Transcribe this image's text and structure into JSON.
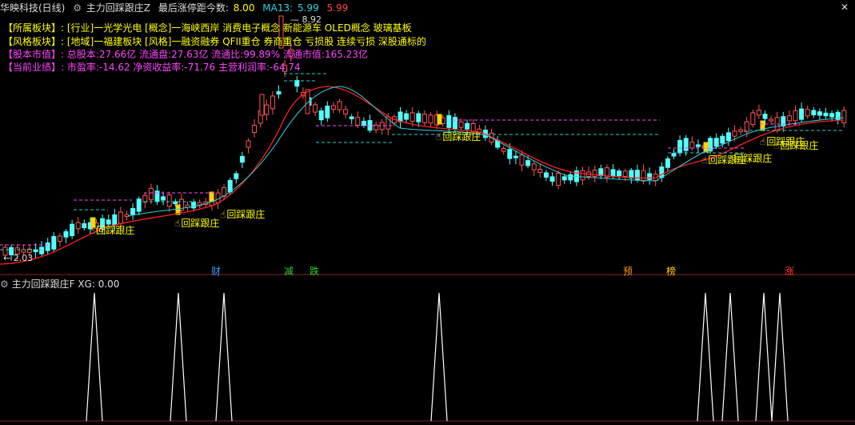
{
  "header": {
    "stock_name": "华映科技(日线)",
    "indicator_name": "主力回踩跟庄Z",
    "stat_label": "最后涨停距今数:",
    "stat_value": "8.00",
    "ma_label": "MA13:",
    "ma_value": "5.99",
    "price_value": "5.99"
  },
  "info_lines": [
    {
      "label": "【所属板块】:",
      "text": "[行业]一光学光电 [概念]一海峡西岸 消费电子概念 新能源车 OLED概念 玻璃基板"
    },
    {
      "label": "【风格板块】:",
      "text": "[地域]一福建板块 [风格]一融资融券 QFII重仓 券商重仓 亏损股 连续亏损 深股通标的"
    },
    {
      "label": "【股本市值】:",
      "text": "总股本:27.66亿 流通盘:27.63亿 流通比:99.89% 流通市值:165.23亿"
    },
    {
      "label": "【当前业绩】:",
      "text": "市盈率:-14.62 净资收益率:-71.76 主营利润率:-64.74"
    }
  ],
  "price_labels": {
    "high": "8.92",
    "low": "2.03"
  },
  "signal_text": "回踩跟庄",
  "events": [
    {
      "text": "财",
      "color": "#3399ff"
    },
    {
      "text": "减",
      "color": "#33cc33"
    },
    {
      "text": "跌",
      "color": "#33cc33"
    },
    {
      "text": "预",
      "color": "#ff9900"
    },
    {
      "text": "榜",
      "color": "#ffcc00"
    },
    {
      "text": "涨",
      "color": "#ff3333"
    }
  ],
  "pane2": {
    "indicator_name": "主力回踩跟庄F",
    "xg_label": "XG:",
    "xg_value": "0.00"
  },
  "icons": {
    "close": "close-icon",
    "settings": "settings-icon",
    "signal": "pointing-hand-icon"
  },
  "colors": {
    "up": "#ff5555",
    "down": "#54ffff",
    "ma_long": "#ff2020",
    "ma_short": "#2ad4e0",
    "signal": "#ffff00",
    "dash_magenta": "#ff44ff",
    "dash_cyan": "#22d3d3"
  }
}
